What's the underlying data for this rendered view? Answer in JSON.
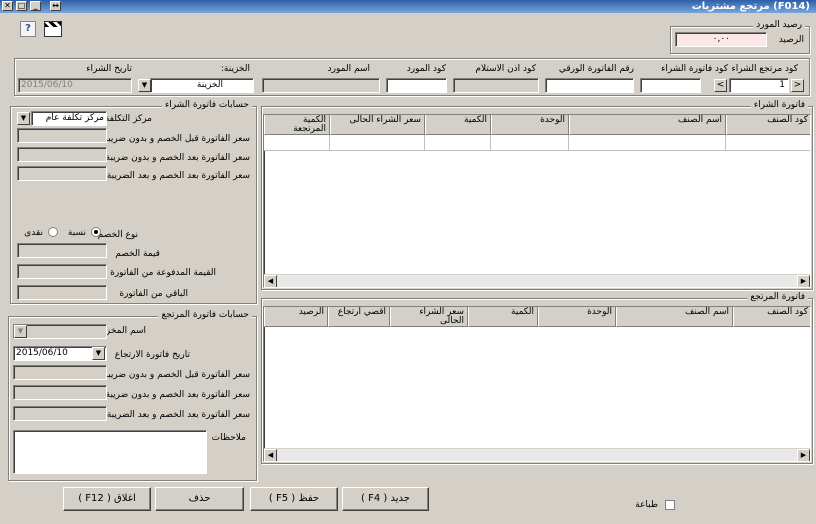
{
  "window": {
    "title": "(F014) مرتجع مشتريات"
  },
  "supplier_balance": {
    "group_title": "رصيد المورد",
    "label": "الرصيد",
    "value": "٠,٠٠"
  },
  "header": {
    "return_code_label": "كود مرتجع الشراء",
    "return_code_value": "1",
    "purchase_invoice_code_label": "كود فاتورة الشراء",
    "paper_invoice_label": "رقم الفاتورة الورقي",
    "receipt_code_label": "كود اذن الاستلام",
    "supplier_code_label": "كود المورد",
    "supplier_name_label": "اسم المورد",
    "safe_label": "الخزينة:",
    "safe_value": "الخزينة",
    "purchase_date_label": "تاريخ الشراء",
    "purchase_date_value": "2015/06/10",
    "prev": "<",
    "next": ">"
  },
  "purchase_calc": {
    "title": "حسابات فاتورة الشراء",
    "cost_center_label": "مركز التكلفة",
    "cost_center_value": "مركز تكلفة عام",
    "before_disc_label": "سعر الفاتورة قبل الخصم و بدون ضريبة",
    "after_disc_label": "سعر الفاتورة بعد الخصم و بدون ضريبة",
    "after_disc_tax_label": "سعر الفاتورة بعد الخصم و بعد الضريبة",
    "discount_type_label": "نوع الخصم",
    "ratio_label": "نسبة",
    "cash_label": "نقدى",
    "discount_value_label": "قيمة الخصم",
    "paid_label": "القيمة المدفوعة من الفاتورة",
    "remaining_label": "الباقي من الفاتورة"
  },
  "return_calc": {
    "title": "حسابات فاتورة المرتجع",
    "store_label": "اسم المخزن",
    "return_date_label": "تاريخ فاتورة الارتجاع",
    "return_date_value": "2015/06/10",
    "before_disc_label": "سعر الفاتورة قبل الخصم و بدون ضريبة",
    "after_disc_label": "سعر الفاتورة بعد الخصم و بدون ضريبة",
    "after_disc_tax_label": "سعر الفاتورة بعد الخصم و بعد الضريبة",
    "notes_label": "ملاحظات"
  },
  "purchase_invoice": {
    "title": "فاتورة الشراء",
    "columns": [
      "كود الصنف",
      "اسم الصنف",
      "الوحدة",
      "الكمية",
      "سعر الشراء الحالى",
      "الكمية المرتجعة"
    ]
  },
  "return_invoice": {
    "title": "فاتورة المرتجع",
    "columns": [
      "كود الصنف",
      "اسم الصنف",
      "الوحدة",
      "الكمية",
      "سعر الشراء الحالى",
      "اقصي ارتجاع",
      "الرصيد"
    ]
  },
  "footer": {
    "new": "جديد ( F4 )",
    "save": "حفظ ( F5 )",
    "delete": "حذف",
    "close": "اغلاق ( F12 )",
    "print": "طباعة"
  }
}
